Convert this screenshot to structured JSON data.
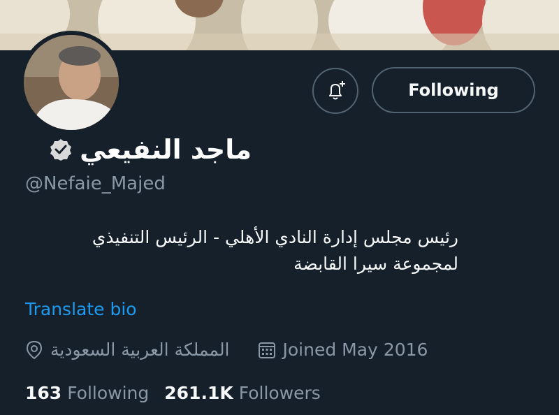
{
  "profile": {
    "name": "ماجد النفيعي",
    "handle": "@Nefaie_Majed",
    "bio": "رئيس مجلس إدارة النادي الأهلي - الرئيس التنفيذي لمجموعة سيرا القابضة",
    "translate_label": "Translate bio",
    "location": "المملكة العربية السعودية",
    "joined": "Joined May 2016",
    "verified": true
  },
  "actions": {
    "follow_label": "Following",
    "notify_icon": "bell-plus-icon"
  },
  "stats": {
    "following_count": "163",
    "following_label": "Following",
    "followers_count": "261.1K",
    "followers_label": "Followers"
  },
  "colors": {
    "background": "#15202b",
    "muted": "#8b98a5",
    "link": "#1d9bf0",
    "border": "#536471"
  }
}
